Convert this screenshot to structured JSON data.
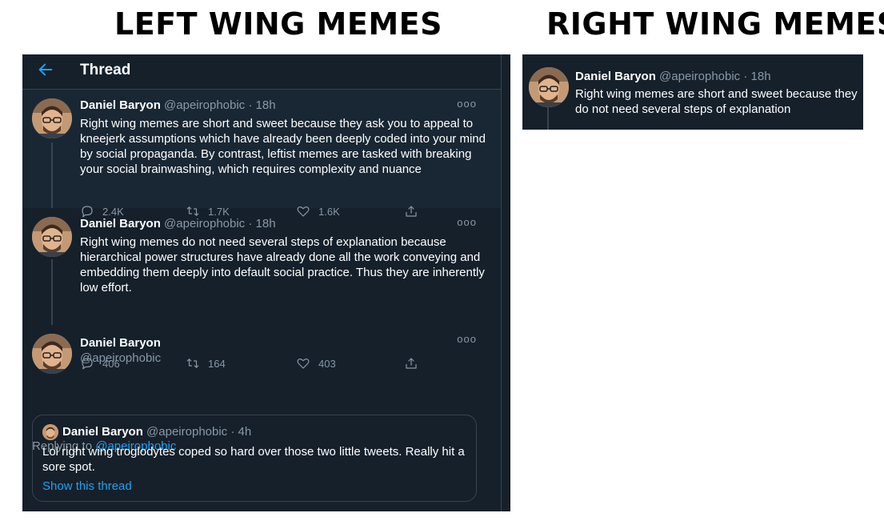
{
  "headings": {
    "left": "LEFT WING MEMES",
    "right": "RIGHT WING MEMES"
  },
  "thread": {
    "title": "Thread",
    "back_icon": "arrow-left-icon",
    "tweets": [
      {
        "name": "Daniel Baryon",
        "handle": "@apeirophobic",
        "separator": "·",
        "time": "18h",
        "more": "ooo",
        "text": "Right wing memes are short and sweet because they ask you to appeal to kneejerk assumptions which have already been deeply coded into your mind by social propaganda. By contrast, leftist memes are tasked with breaking your social brainwashing, which requires complexity and nuance",
        "replies": "2.4K",
        "retweets": "1.7K",
        "likes": "1.6K"
      },
      {
        "name": "Daniel Baryon",
        "handle": "@apeirophobic",
        "separator": "·",
        "time": "18h",
        "more": "ooo",
        "text": "Right wing memes do not need several steps of explanation because hierarchical power structures have already done all the work conveying and embedding them deeply into default social practice. Thus they are inherently low effort.",
        "replies": "406",
        "retweets": "164",
        "likes": "403"
      },
      {
        "name": "Daniel Baryon",
        "handle": "@apeirophobic",
        "more": "ooo",
        "replying_prefix": "Replying to",
        "replying_to": "@apeirophobic",
        "quote": {
          "name": "Daniel Baryon",
          "handle": "@apeirophobic",
          "separator": "·",
          "time": "4h",
          "text": "Lol right wing troglodytes coped so hard over those two little tweets. Really hit a sore spot.",
          "link": "Show this thread"
        }
      }
    ]
  },
  "right_tweet": {
    "name": "Daniel Baryon",
    "handle": "@apeirophobic",
    "separator": "·",
    "time": "18h",
    "text": "Right wing memes are short and sweet because they do not need several steps of explanation"
  },
  "colors": {
    "background": "#15202b",
    "highlight": "#192734",
    "border": "#38444d",
    "muted": "#8899a6",
    "accent": "#1da1f2"
  }
}
